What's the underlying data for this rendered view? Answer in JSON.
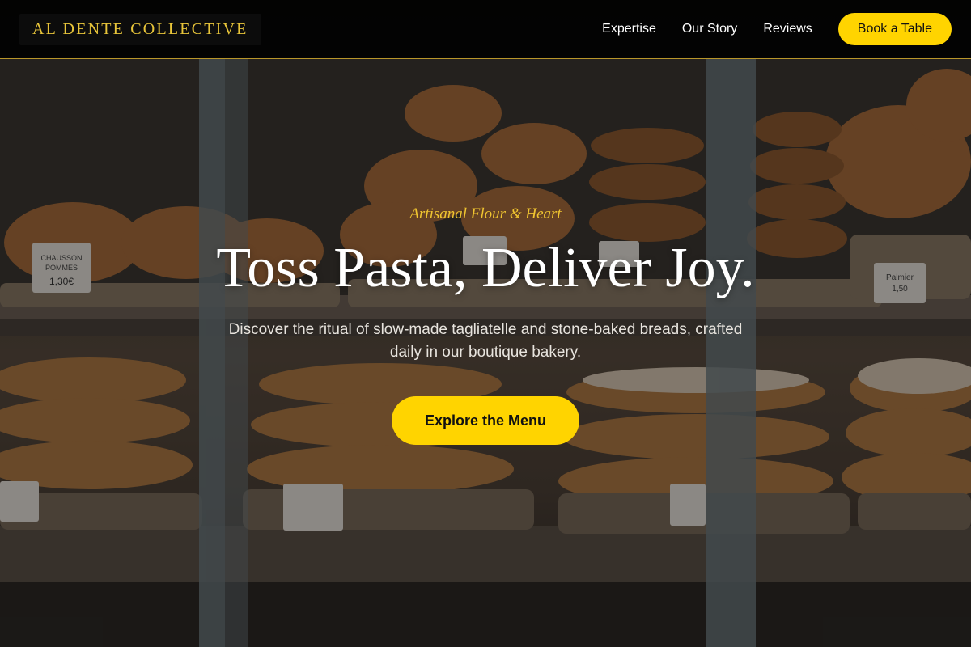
{
  "header": {
    "logo": "AL DENTE COLLECTIVE",
    "nav": [
      {
        "label": "Expertise"
      },
      {
        "label": "Our Story"
      },
      {
        "label": "Reviews"
      }
    ],
    "cta_label": "Book a Table"
  },
  "hero": {
    "eyebrow": "Artisanal Flour & Heart",
    "headline": "Toss Pasta, Deliver Joy.",
    "subcopy": "Discover the ritual of slow-made tagliatelle and stone-baked breads, crafted daily in our boutique bakery.",
    "cta_label": "Explore the Menu",
    "price_tags": [
      "CHAUSSON",
      "POMMES",
      "1,30€",
      "Palmier",
      "1,50"
    ]
  },
  "colors": {
    "accent": "#ffd400",
    "eyebrow": "#f0c530",
    "header_bg": "#000000",
    "header_border": "#b8962a"
  },
  "icons": []
}
